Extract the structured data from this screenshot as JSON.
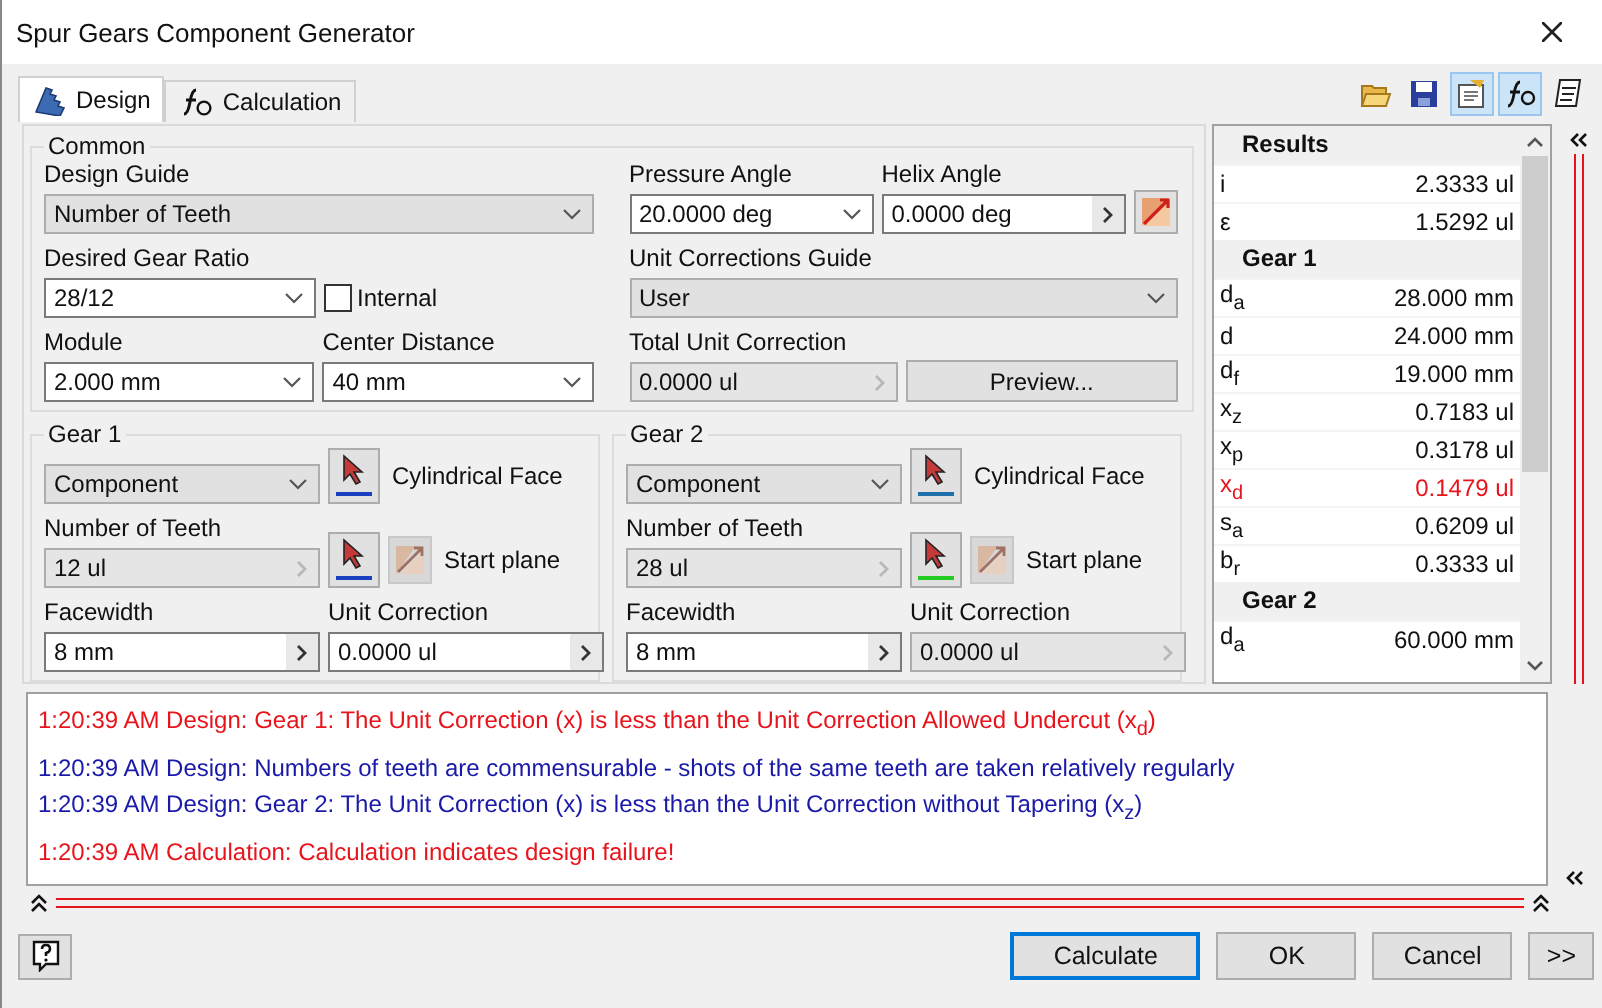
{
  "window": {
    "title": "Spur Gears Component Generator"
  },
  "tabs": [
    {
      "label": "Design",
      "kind": "gear",
      "selected": true
    },
    {
      "label": "Calculation",
      "kind": "formula",
      "selected": false
    }
  ],
  "toolbar": [
    {
      "kind": "folder",
      "selected": false
    },
    {
      "kind": "save",
      "selected": false
    },
    {
      "kind": "properties",
      "selected": true
    },
    {
      "kind": "formula",
      "selected": true
    },
    {
      "kind": "notes",
      "selected": false
    }
  ],
  "groups": [
    {
      "title": "Common",
      "columns": [
        [
          [
            {
              "kind": "dropdown",
              "label": "Design Guide",
              "value": "Number of Teeth",
              "disabled": true
            }
          ],
          [
            {
              "kind": "dropdown",
              "label": "Desired Gear Ratio",
              "value": "28/12",
              "disabled": false
            },
            {
              "kind": "checkbox",
              "label": "Internal",
              "checked": false
            }
          ],
          [
            {
              "kind": "dropdown",
              "label": "Module",
              "value": "2.000 mm",
              "disabled": false
            },
            {
              "kind": "dropdown",
              "label": "Center Distance",
              "value": "40 mm",
              "disabled": false
            }
          ]
        ],
        [
          [
            {
              "kind": "dropdown",
              "label": "Pressure Angle",
              "value": "20.0000 deg",
              "disabled": false
            },
            {
              "kind": "spin",
              "label": "Helix Angle",
              "value": "0.0000 deg",
              "disabled": false
            },
            {
              "kind": "flip"
            }
          ],
          [
            {
              "kind": "dropdown",
              "label": "Unit Corrections Guide",
              "value": "User",
              "disabled": true
            }
          ],
          [
            {
              "kind": "spin",
              "label": "Total Unit Correction",
              "value": "0.0000 ul",
              "disabled": true
            },
            {
              "kind": "button",
              "label": "Preview..."
            }
          ]
        ]
      ]
    },
    {
      "title": "Gear 1",
      "columns": [
        [
          [
            {
              "kind": "dropdown",
              "value": "Component",
              "disabled": true
            },
            {
              "kind": "pick",
              "label": "Cylindrical Face",
              "color": "#1a3fc0"
            }
          ],
          [
            {
              "kind": "spin",
              "label": "Number of Teeth",
              "value": "12 ul",
              "disabled": true
            },
            {
              "kind": "pick-plane",
              "label": "Start plane",
              "color": "#1a3fc0"
            }
          ],
          [
            {
              "kind": "spin",
              "label": "Facewidth",
              "value": "8 mm",
              "disabled": false
            },
            {
              "kind": "spin",
              "label": "Unit Correction",
              "value": "0.0000 ul",
              "disabled": false
            }
          ]
        ]
      ]
    },
    {
      "title": "Gear 2",
      "columns": [
        [
          [
            {
              "kind": "dropdown",
              "value": "Component",
              "disabled": true
            },
            {
              "kind": "pick",
              "label": "Cylindrical Face",
              "color": "#1f6fa8"
            }
          ],
          [
            {
              "kind": "spin",
              "label": "Number of Teeth",
              "value": "28 ul",
              "disabled": true
            },
            {
              "kind": "pick-plane",
              "label": "Start plane",
              "color": "#22cc22"
            }
          ],
          [
            {
              "kind": "spin",
              "label": "Facewidth",
              "value": "8 mm",
              "disabled": false
            },
            {
              "kind": "spin",
              "label": "Unit Correction",
              "value": "0.0000 ul",
              "disabled": true
            }
          ]
        ]
      ]
    }
  ],
  "results": [
    {
      "kind": "header",
      "label": "Results"
    },
    {
      "kind": "value",
      "name": "i",
      "value": "2.3333 ul",
      "warning": false
    },
    {
      "kind": "value",
      "name": "ε",
      "value": "1.5292 ul",
      "warning": false
    },
    {
      "kind": "header",
      "label": "Gear 1"
    },
    {
      "kind": "value",
      "name": "d$_{a}$",
      "value": "28.000 mm",
      "warning": false
    },
    {
      "kind": "value",
      "name": "d",
      "value": "24.000 mm",
      "warning": false
    },
    {
      "kind": "value",
      "name": "d$_{f}$",
      "value": "19.000 mm",
      "warning": false
    },
    {
      "kind": "value",
      "name": "x$_{z}$",
      "value": "0.7183 ul",
      "warning": false
    },
    {
      "kind": "value",
      "name": "x$_{p}$",
      "value": "0.3178 ul",
      "warning": false
    },
    {
      "kind": "value",
      "name": "x$_{d}$",
      "value": "0.1479 ul",
      "warning": true
    },
    {
      "kind": "value",
      "name": "s$_{a}$",
      "value": "0.6209 ul",
      "warning": false
    },
    {
      "kind": "value",
      "name": "b$_{r}$",
      "value": "0.3333 ul",
      "warning": false
    },
    {
      "kind": "header",
      "label": "Gear 2"
    },
    {
      "kind": "value",
      "name": "d$_{a}$",
      "value": "60.000 mm",
      "warning": false
    }
  ],
  "messages": [
    {
      "color": "#e8141c",
      "text": "1:20:39 AM Design: Gear 1: The Unit Correction (x) is less than the Unit Correction Allowed Undercut (x$_{d}$)"
    },
    {
      "color": "#1a1aa8",
      "text": "1:20:39 AM Design: Numbers of teeth are commensurable - shots of the same teeth are taken relatively regularly"
    },
    {
      "color": "#1a1aa8",
      "text": "1:20:39 AM Design: Gear 2: The Unit Correction (x) is less than the Unit Correction without Tapering (x$_{z}$)"
    },
    {
      "color": "#e8141c",
      "text": "1:20:39 AM Calculation: Calculation indicates design failure!"
    }
  ],
  "buttons": [
    {
      "label": "Calculate",
      "default": true
    },
    {
      "label": "OK",
      "default": false
    },
    {
      "label": "Cancel",
      "default": false
    },
    {
      "label": ">>",
      "default": false
    }
  ]
}
